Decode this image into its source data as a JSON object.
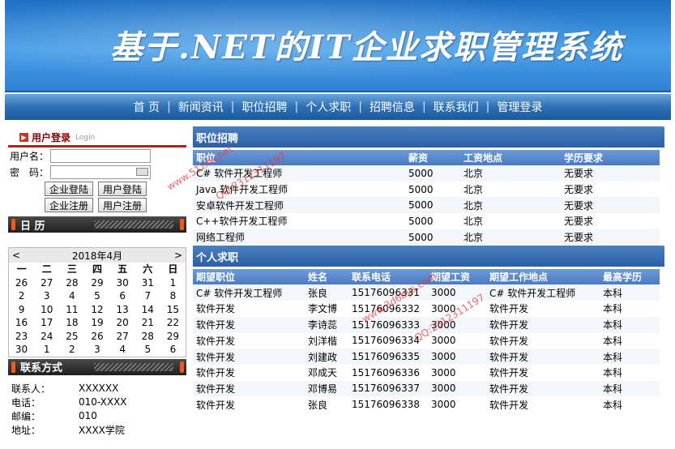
{
  "banner": {
    "title": "基于.NET的IT企业求职管理系统"
  },
  "nav": [
    "首 页",
    "新闻资讯",
    "职位招聘",
    "个人求职",
    "招聘信息",
    "联系我们",
    "管理登录"
  ],
  "login": {
    "title": "用户登录",
    "subtitle": "Login",
    "username_label": "用户名：",
    "password_label": "密　码：",
    "username_value": "",
    "password_value": "",
    "buttons": [
      "企业登陆",
      "用户登陆",
      "企业注册",
      "用户注册"
    ]
  },
  "calendar_bar": {
    "title": "日 历"
  },
  "calendar": {
    "month": "2018年4月",
    "prev": "<",
    "next": ">",
    "weekdays": [
      "一",
      "二",
      "三",
      "四",
      "五",
      "六",
      "日"
    ],
    "days": [
      "26",
      "27",
      "28",
      "29",
      "30",
      "31",
      "1",
      "2",
      "3",
      "4",
      "5",
      "6",
      "7",
      "8",
      "9",
      "10",
      "11",
      "12",
      "13",
      "14",
      "15",
      "16",
      "17",
      "18",
      "19",
      "20",
      "21",
      "22",
      "23",
      "24",
      "25",
      "26",
      "27",
      "28",
      "29",
      "30",
      "1",
      "2",
      "3",
      "4",
      "5",
      "6"
    ]
  },
  "contact_bar": {
    "title": "联系方式"
  },
  "contact": [
    {
      "k": "联系人：",
      "v": "XXXXXX"
    },
    {
      "k": "电话：",
      "v": "010-XXXX"
    },
    {
      "k": "邮编：",
      "v": "010"
    },
    {
      "k": "地址：",
      "v": "XXXX学院"
    }
  ],
  "jobs": {
    "title": "职位招聘",
    "headers": [
      "职位",
      "薪资",
      "工资地点",
      "学历要求"
    ],
    "rows": [
      [
        "C# 软件开发工程师",
        "5000",
        "北京",
        "无要求"
      ],
      [
        "Java 软件开发工程师",
        "5000",
        "北京",
        "无要求"
      ],
      [
        "安卓软件开发工程师",
        "5000",
        "北京",
        "无要求"
      ],
      [
        "C++软件开发工程师",
        "5000",
        "北京",
        "无要求"
      ],
      [
        "网络工程师",
        "5000",
        "北京",
        "无要求"
      ]
    ]
  },
  "seekers": {
    "title": "个人求职",
    "headers": [
      "期望职位",
      "姓名",
      "联系电话",
      "期望工资",
      "期望工作地点",
      "最高学历"
    ],
    "rows": [
      [
        "C# 软件开发工程师",
        "张良",
        "15176096331",
        "3000",
        "C# 软件开发工程师",
        "本科"
      ],
      [
        "软件开发",
        "李文博",
        "15176096332",
        "3000",
        "软件开发",
        "本科"
      ],
      [
        "软件开发",
        "李诗蕊",
        "15176096333",
        "3000",
        "软件开发",
        "本科"
      ],
      [
        "软件开发",
        "刘洋楷",
        "15176096334",
        "3000",
        "软件开发",
        "本科"
      ],
      [
        "软件开发",
        "刘建政",
        "15176096335",
        "3000",
        "软件开发",
        "本科"
      ],
      [
        "软件开发",
        "邓成天",
        "15176096336",
        "3000",
        "软件开发",
        "本科"
      ],
      [
        "软件开发",
        "邓博易",
        "15176096337",
        "3000",
        "软件开发",
        "本科"
      ],
      [
        "软件开发",
        "张良",
        "15176096338",
        "3000",
        "软件开发",
        "本科"
      ]
    ]
  },
  "watermarks": [
    "www.51zxw.net",
    "QQ:2312311197",
    "www.3d6bys.com",
    "QQ:2312311197"
  ]
}
